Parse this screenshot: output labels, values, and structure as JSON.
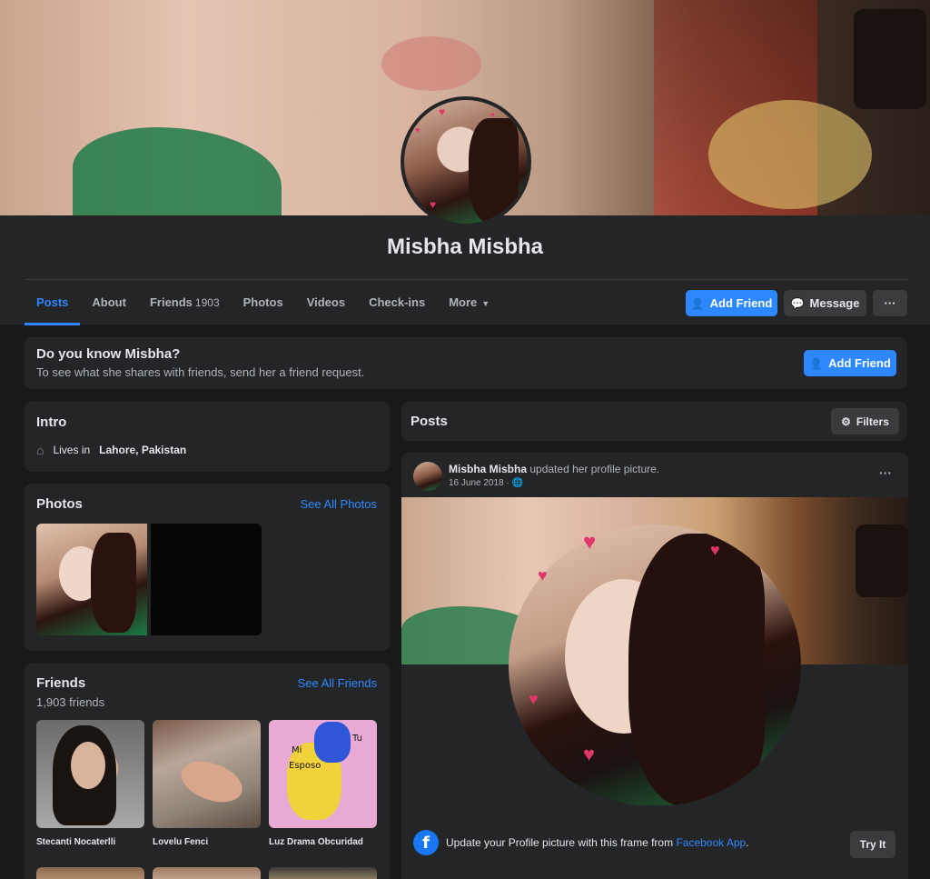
{
  "profile": {
    "name": "Misbha Misbha"
  },
  "nav": {
    "tabs": [
      {
        "label": "Posts"
      },
      {
        "label": "About"
      },
      {
        "label": "Friends",
        "count": "1903"
      },
      {
        "label": "Photos"
      },
      {
        "label": "Videos"
      },
      {
        "label": "Check-ins"
      },
      {
        "label": "More"
      }
    ],
    "add_friend_label": "Add Friend",
    "message_label": "Message",
    "more_label": "···"
  },
  "know_card": {
    "title": "Do you know Misbha?",
    "subtitle": "To see what she shares with friends, send her a friend request.",
    "button_label": "Add Friend"
  },
  "intro": {
    "title": "Intro",
    "lives_prefix": "Lives in",
    "location": "Lahore, Pakistan"
  },
  "photos": {
    "title": "Photos",
    "see_all": "See All Photos"
  },
  "friends": {
    "title": "Friends",
    "count_text": "1,903 friends",
    "see_all": "See All Friends",
    "items": [
      {
        "name": "Stecanti Nocaterlli"
      },
      {
        "name": "Lovelu Fenci"
      },
      {
        "name": "Luz Drama Obcuridad",
        "tags": [
          "Mi",
          "Esposo",
          "Tu"
        ]
      }
    ]
  },
  "posts": {
    "title": "Posts",
    "filters_label": "Filters",
    "post": {
      "author": "Misbha Misbha",
      "action": "updated her profile picture.",
      "date": "16 June 2018 ·",
      "more": "···",
      "frame_text": "Update your Profile picture with this frame from",
      "frame_link": "Facebook App",
      "frame_end": ".",
      "try_label": "Try It"
    }
  },
  "colors": {
    "accent": "#2d88ff",
    "background": "#18191a",
    "card": "#242526"
  }
}
